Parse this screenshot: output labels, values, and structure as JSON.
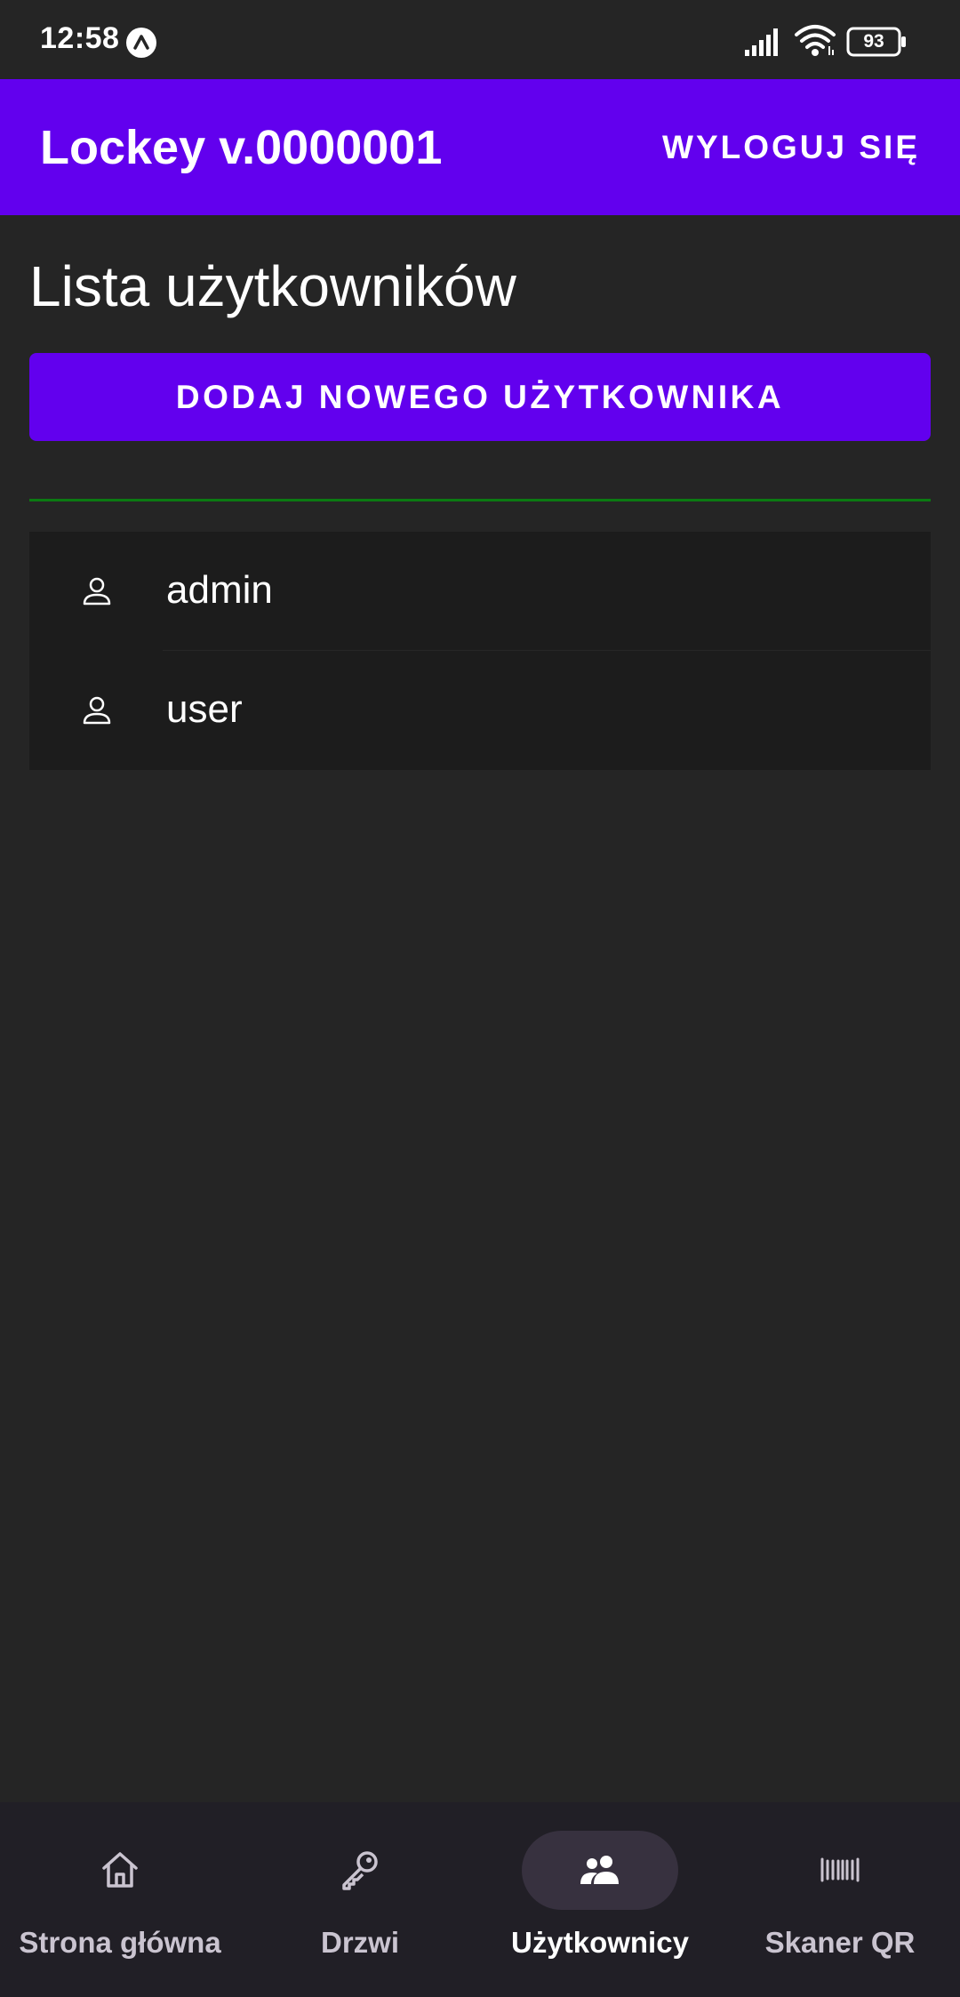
{
  "status_bar": {
    "time": "12:58",
    "battery": "93",
    "icons": [
      "app-notification-icon",
      "signal-icon",
      "wifi-icon",
      "battery-icon"
    ]
  },
  "app_bar": {
    "title": "Lockey v.0000001",
    "logout_label": "WYLOGUJ SIĘ"
  },
  "main": {
    "title": "Lista użytkowników",
    "add_user_label": "DODAJ NOWEGO UŻYTKOWNIKA",
    "users": [
      {
        "name": "admin",
        "icon": "person-icon"
      },
      {
        "name": "user",
        "icon": "person-icon"
      }
    ]
  },
  "bottom_nav": {
    "items": [
      {
        "label": "Strona główna",
        "icon": "home-icon",
        "active": false
      },
      {
        "label": "Drzwi",
        "icon": "key-icon",
        "active": false
      },
      {
        "label": "Użytkownicy",
        "icon": "people-icon",
        "active": true
      },
      {
        "label": "Skaner QR",
        "icon": "barcode-icon",
        "active": false
      }
    ]
  },
  "colors": {
    "background": "#252525",
    "primary": "#6200ee",
    "divider": "#0b7a12",
    "list_background": "#1c1c1c",
    "nav_background": "#211f26",
    "nav_active_pill": "#37313f"
  }
}
